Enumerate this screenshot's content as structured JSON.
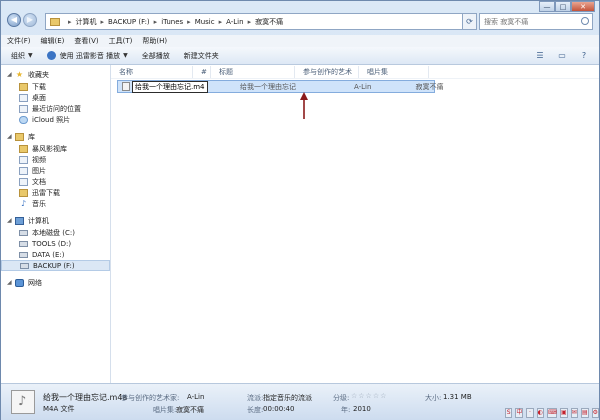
{
  "address_bar": {
    "crumbs": [
      "计算机",
      "BACKUP (F:)",
      "iTunes",
      "Music",
      "A-Lin",
      "寂寞不痛"
    ]
  },
  "search": {
    "placeholder": "搜索 寂寞不痛"
  },
  "window_controls": {
    "minimize": "—",
    "maximize": "□",
    "close": "✕"
  },
  "menu": {
    "items": [
      "文件(F)",
      "编辑(E)",
      "查看(V)",
      "工具(T)",
      "帮助(H)"
    ]
  },
  "toolbar": {
    "organize": "组织",
    "play_with": "使用 迅雷影音 播放",
    "play_all": "全部播放",
    "new_folder": "新建文件夹"
  },
  "nav": {
    "favorites": {
      "label": "收藏夹",
      "items": [
        "下载",
        "桌面",
        "最近访问的位置",
        "iCloud 照片"
      ]
    },
    "libraries": {
      "label": "库",
      "items": [
        "暴风影视库",
        "视频",
        "图片",
        "文档",
        "迅雷下载",
        "音乐"
      ]
    },
    "computer": {
      "label": "计算机",
      "items": [
        "本地磁盘 (C:)",
        "TOOLS (D:)",
        "DATA (E:)",
        "BACKUP (F:)"
      ]
    },
    "network": {
      "label": "网络"
    }
  },
  "columns": [
    "名称",
    "#",
    "标题",
    "参与创作的艺术家",
    "唱片集"
  ],
  "file": {
    "rename_value": "给我一个理由忘记.m4a",
    "title": "给我一个理由忘记",
    "artist": "A-Lin",
    "album": "寂寞不痛"
  },
  "status": {
    "name": "给我一个理由忘记.m4a",
    "type": "M4A 文件",
    "artist_label": "参与创作的艺术家:",
    "artist": "A-Lin",
    "album_label": "唱片集:",
    "album": "寂寞不痛",
    "genre_label": "流派:",
    "genre": "指定音乐的流派",
    "length_label": "长度:",
    "length": "00:00:40",
    "rating_label": "分级:",
    "rating_stars": "☆☆☆☆☆",
    "year_label": "年:",
    "year": "2010",
    "size_label": "大小:",
    "size": "1.31 MB"
  },
  "tray": {
    "icons": [
      "S",
      "中",
      "·",
      "◐",
      "⌨",
      "▣",
      "✉",
      "▤",
      "⚙"
    ]
  },
  "colors": {
    "accent": "#3b74c4",
    "selection": "#cfe3fa",
    "close": "#c4533a"
  }
}
